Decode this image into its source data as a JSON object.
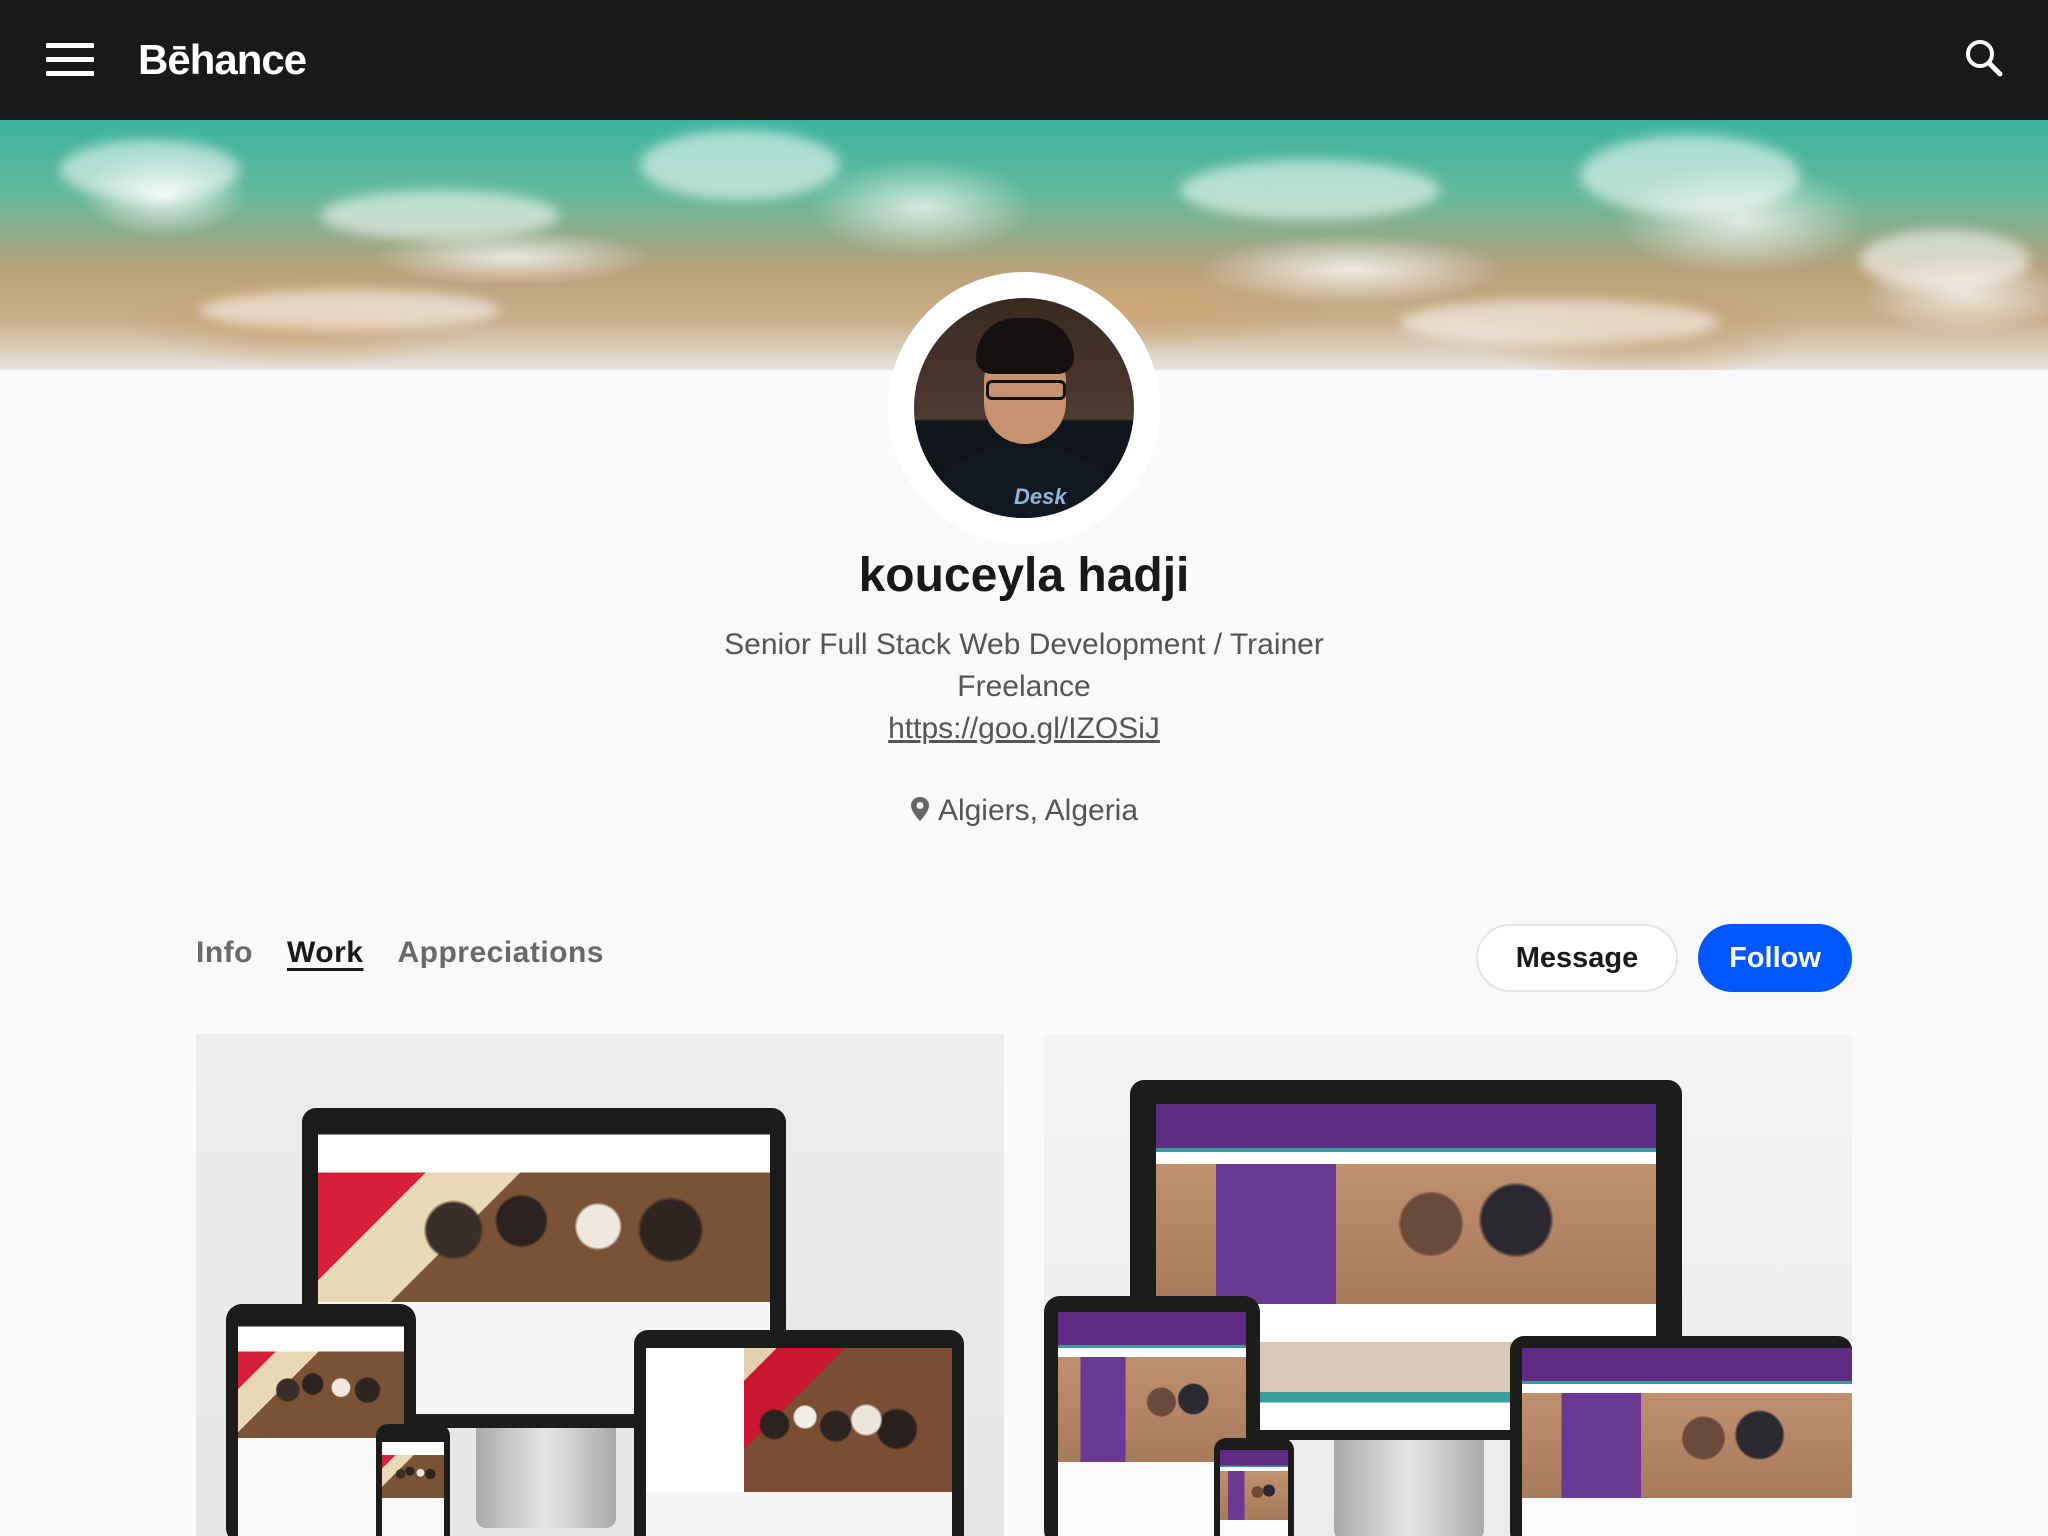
{
  "header": {
    "brand": "Bēhance"
  },
  "profile": {
    "name": "kouceyla hadji",
    "occupation": "Senior Full Stack Web Development / Trainer",
    "company": "Freelance",
    "website": "https://goo.gl/IZOSiJ",
    "location": "Algiers, Algeria",
    "avatar_shirt_text": "Desk"
  },
  "tabs": [
    {
      "label": "Info",
      "active": false
    },
    {
      "label": "Work",
      "active": true
    },
    {
      "label": "Appreciations",
      "active": false
    }
  ],
  "actions": {
    "message_label": "Message",
    "follow_label": "Follow"
  },
  "colors": {
    "topbar": "#191919",
    "accent": "#0057ff",
    "page_bg": "#f9f9f9"
  },
  "icons": {
    "menu": "hamburger-icon",
    "search": "search-icon",
    "location": "map-pin-icon"
  }
}
